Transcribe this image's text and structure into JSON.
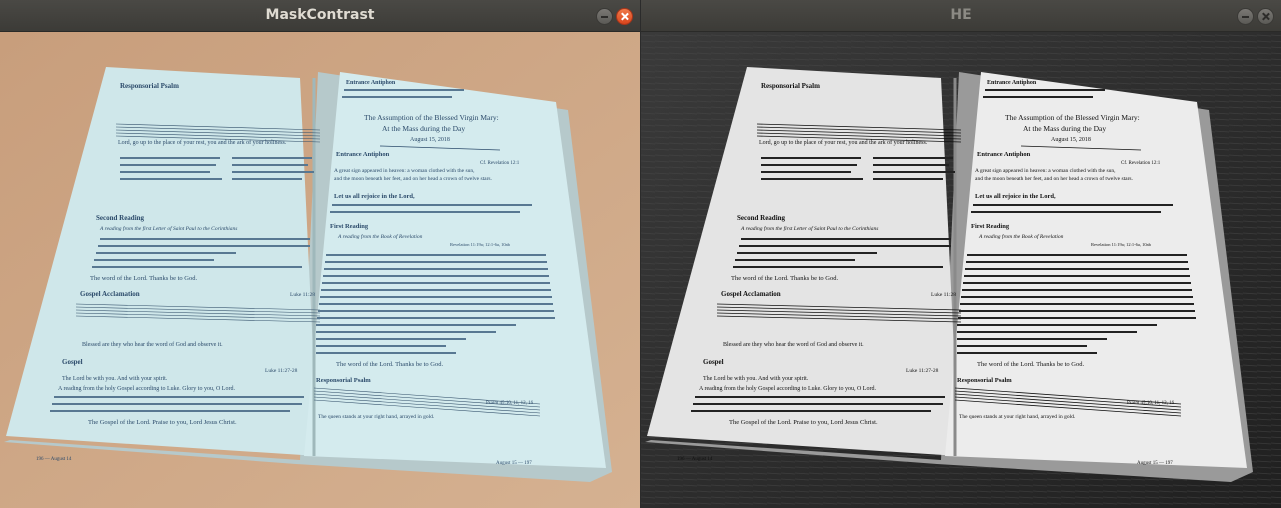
{
  "windows": [
    {
      "title": "MaskContrast"
    },
    {
      "title": "HE"
    }
  ],
  "book": {
    "left_header": "Responsorial Psalm",
    "left_verse1": "Lord, go up to the place of your rest, you and the ark of your holiness.",
    "left_second_reading": "Second Reading",
    "left_second_reading_source": "A reading from the first Letter of Saint Paul to the Corinthians",
    "left_thanks": "The word of the Lord. Thanks be to God.",
    "left_acclamation": "Gospel Acclamation",
    "left_acclamation_ref": "Luke 11:28",
    "left_blessed": "Blessed are they who hear the word of God and observe it.",
    "left_gospel": "Gospel",
    "left_gospel_ref": "Luke 11:27-28",
    "left_gospel_line1": "The Lord be with you. And with your spirit.",
    "left_gospel_line2": "A reading from the holy Gospel according to Luke. Glory to you, O Lord.",
    "left_gospel_end": "The Gospel of the Lord. Praise to you, Lord Jesus Christ.",
    "left_page_no": "196 — August 14",
    "right_header": "Entrance Antiphon",
    "right_title1": "The Assumption of the Blessed Virgin Mary:",
    "right_title2": "At the Mass during the Day",
    "right_date": "August 15, 2018",
    "right_antiphon": "Entrance Antiphon",
    "right_antiphon_ref": "Cf. Revelation 12:1",
    "right_antiphon_line1": "A great sign appeared in heaven: a woman clothed with the sun,",
    "right_antiphon_line2": "and the moon beneath her feet, and on her head a crown of twelve stars.",
    "right_rejoice": "Let us all rejoice in the Lord,",
    "right_reading": "First Reading",
    "right_reading_source": "A reading from the Book of Revelation",
    "right_reading_ref": "Revelation 11:19a; 12:1-6a, 10ab",
    "right_thanks": "The word of the Lord. Thanks be to God.",
    "right_psalm": "Responsorial Psalm",
    "right_psalm_ref": "Psalm 45:10, 11, 12, 16",
    "right_psalm_text": "The queen stands at your right hand, arrayed in gold.",
    "right_page_no": "August 15 — 197"
  },
  "colors": {
    "page_tint": "#cfe7ea",
    "table": "#c9a383",
    "grey_page": "#e6e6e6",
    "grey_table": "#2f2f2f"
  }
}
